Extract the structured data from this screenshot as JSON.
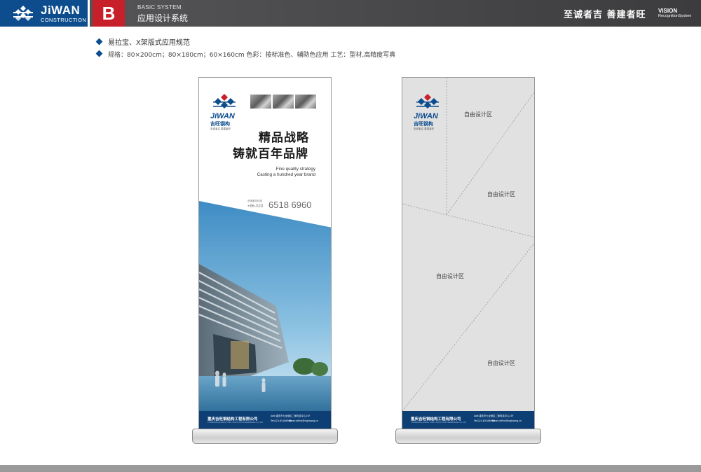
{
  "header": {
    "brand_name": "JiWAN",
    "brand_sub": "CONSTRUCTION",
    "section_letter": "B",
    "system_en": "BASIC SYSTEM",
    "system_cn": "应用设计系统",
    "slogan": "至诚者吉  善建者旺",
    "vision": "VISION",
    "vision_sub": "RecognitionSystem"
  },
  "spec": {
    "title": "易拉宝、X架版式应用规范",
    "details": "规格：80×200cm；80×180cm；60×160cm    色彩：按标准色、辅助色应用    工艺：型材,高精度写真"
  },
  "banner_left": {
    "brand": "JiWAN",
    "brand_cn": "吉旺钢构",
    "tagline": "至诚者吉  善建者旺",
    "headline_1": "精品战略",
    "headline_2": "铸就百年品牌",
    "en_line_1": "Fine quality strategy",
    "en_line_2": "Casting a hundred year brand",
    "tel_label": "咨询服务热线",
    "tel_code": "+86-023",
    "tel_number": "6518 6960",
    "footer_company": "重庆吉旺钢结构工程有限公司",
    "footer_company_en": "CHONGQING JIWANG STEEL STRUCTURE ENGINEERING CO.,LTD",
    "footer_addr": "Add:重庆市九龙坡区二郎科技中心15F",
    "footer_tel": "Tel:023-65186960",
    "footer_email": "Email:office@cqjiwang.cn"
  },
  "banner_right": {
    "brand": "JiWAN",
    "brand_cn": "吉旺钢构",
    "tagline": "至诚者吉  善建者旺",
    "zones": [
      "自由设计区",
      "自由设计区",
      "自由设计区",
      "自由设计区"
    ],
    "footer_company": "重庆吉旺钢结构工程有限公司",
    "footer_company_en": "CHONGQING JIWANG STEEL STRUCTURE ENGINEERING CO.,LTD",
    "footer_addr": "Add:重庆市九龙坡区二郎科技中心15F",
    "footer_tel": "Tel:023-65186960",
    "footer_email": "Email:office@cqjiwang.cn"
  },
  "colors": {
    "brand_blue": "#0d4d8e",
    "brand_red": "#c8202a",
    "header_gray": "#4a4a4c",
    "footer_navy": "#0d3f75"
  }
}
